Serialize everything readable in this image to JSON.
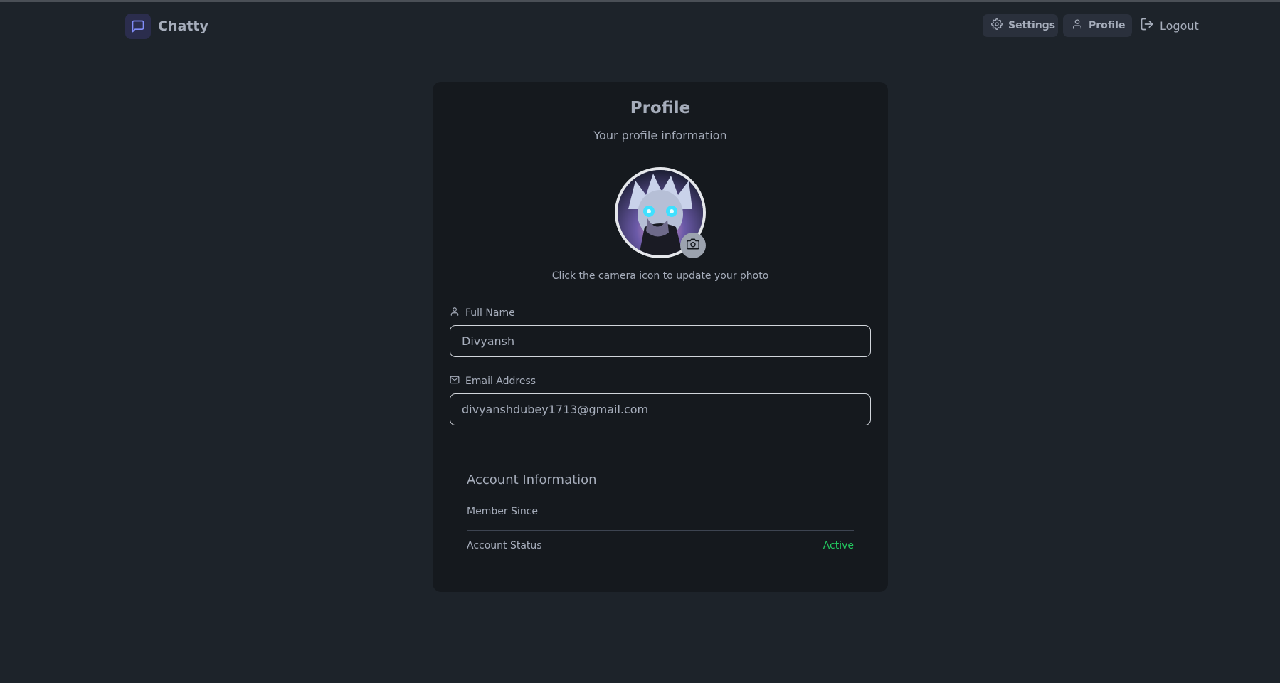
{
  "header": {
    "app_name": "Chatty",
    "nav": {
      "settings": "Settings",
      "profile": "Profile",
      "logout": "Logout"
    }
  },
  "profile_card": {
    "title": "Profile",
    "subtitle": "Your profile information",
    "avatar_hint": "Click the camera icon to update your photo",
    "full_name_label": "Full Name",
    "full_name_value": "Divyansh",
    "email_label": "Email Address",
    "email_value": "divyanshdubey1713@gmail.com"
  },
  "account_info": {
    "title": "Account Information",
    "member_since_label": "Member Since",
    "member_since_value": "",
    "status_label": "Account Status",
    "status_value": "Active"
  },
  "colors": {
    "background": "#1d232a",
    "card": "#15191e",
    "status_active": "#22c55e",
    "brand_icon": "#818cf8"
  },
  "icons": [
    "message-square-icon",
    "gear-icon",
    "user-icon",
    "logout-icon",
    "camera-icon",
    "mail-icon"
  ]
}
